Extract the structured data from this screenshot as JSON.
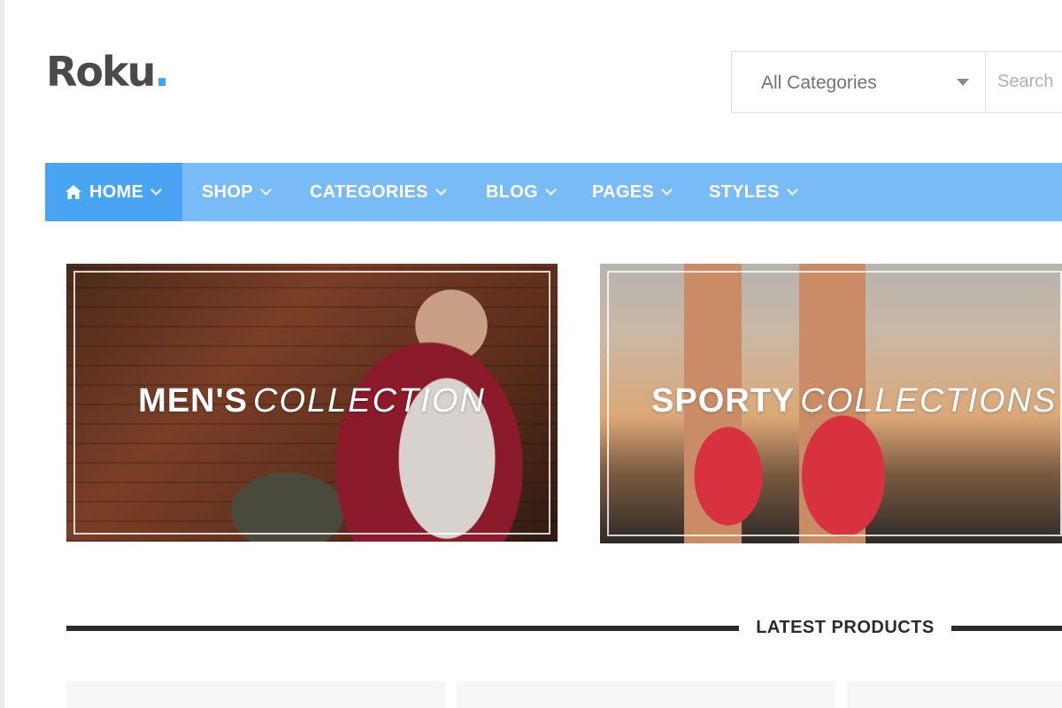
{
  "brand": {
    "name": "Roku",
    "dot": ".",
    "accent": "#3da2f5"
  },
  "search": {
    "category": "All Categories",
    "placeholder": "Search"
  },
  "nav": {
    "background": "#78bbf6",
    "active_background": "#49a5f3",
    "items": [
      {
        "label": "HOME",
        "icon": "home-icon",
        "active": true
      },
      {
        "label": "SHOP"
      },
      {
        "label": "CATEGORIES"
      },
      {
        "label": "BLOG"
      },
      {
        "label": "PAGES"
      },
      {
        "label": "STYLES"
      }
    ]
  },
  "banners": [
    {
      "bold": "MEN'S",
      "italic": "COLLECTION"
    },
    {
      "bold": "SPORTY",
      "italic": "COLLECTIONS"
    }
  ],
  "section": {
    "title": "LATEST PRODUCTS"
  }
}
